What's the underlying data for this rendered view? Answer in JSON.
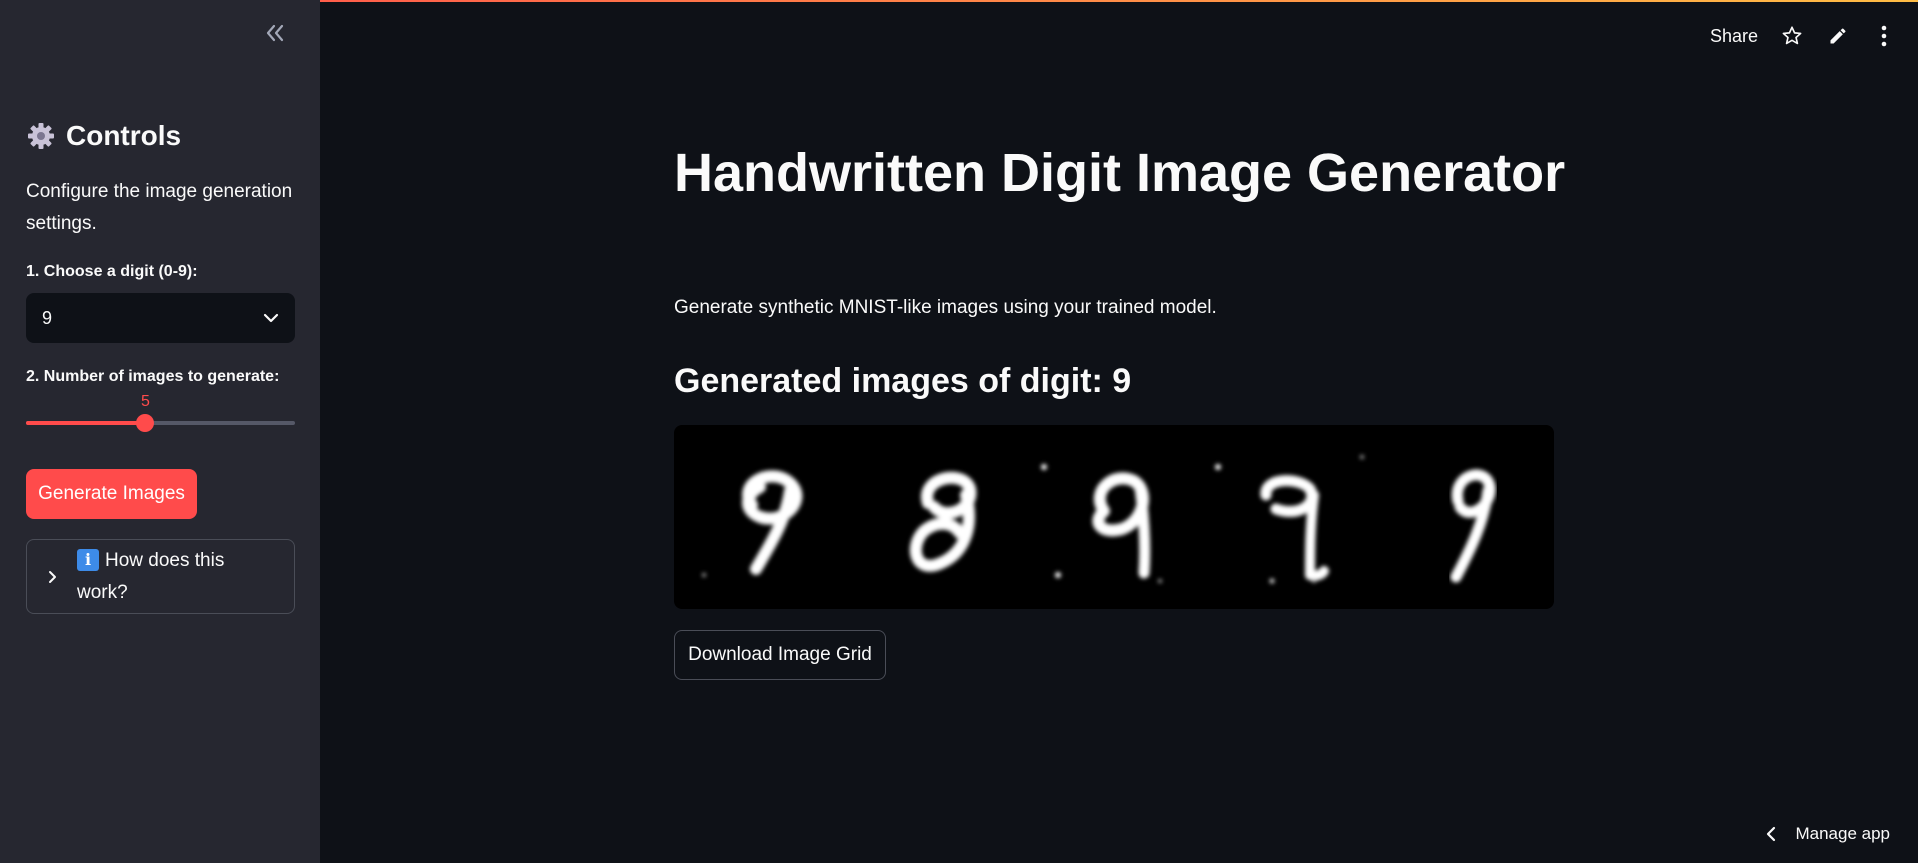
{
  "header": {
    "share_label": "Share",
    "icons": [
      "star-icon",
      "pencil-icon",
      "more-vertical-icon"
    ]
  },
  "sidebar": {
    "collapse_icon": "double-chevron-left-icon",
    "title": "Controls",
    "title_icon": "gear-icon",
    "description": "Configure the image generation settings.",
    "digit_label": "1. Choose a digit (0-9):",
    "digit_value": "9",
    "count_label": "2. Number of images to generate:",
    "count_value": "5",
    "count_fraction": 0.444,
    "generate_label": "Generate Images",
    "expander_icon": "info-icon",
    "expander_label": "How does this work?"
  },
  "main": {
    "title": "Handwritten Digit Image Generator",
    "description": "Generate synthetic MNIST-like images using your trained model.",
    "subheading": "Generated images of digit: 9",
    "image_digits": [
      "9",
      "9",
      "9",
      "9",
      "9"
    ],
    "download_label": "Download Image Grid"
  },
  "footer": {
    "manage_label": "Manage app"
  },
  "colors": {
    "accent": "#ff4b4b",
    "background": "#0e1117",
    "sidebar_bg": "#262730"
  }
}
